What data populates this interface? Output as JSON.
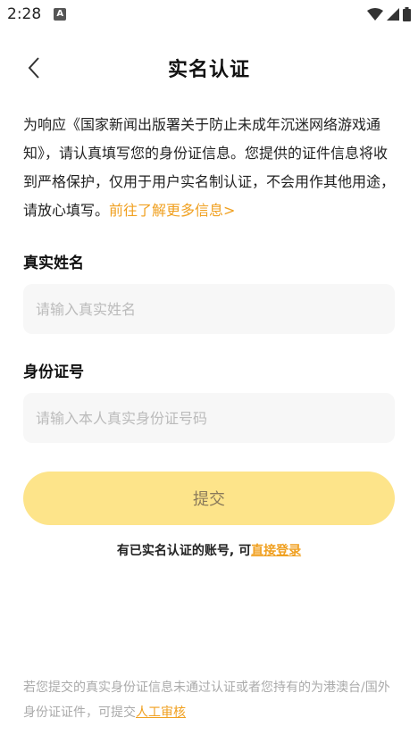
{
  "status_bar": {
    "time": "2:28",
    "notification_glyph": "A"
  },
  "header": {
    "title": "实名认证"
  },
  "intro": {
    "text": "为响应《国家新闻出版署关于防止未成年沉迷网络游戏通知》，请认真填写您的身份证信息。您提供的证件信息将收到严格保护，仅用于用户实名制认证，不会用作其他用途，请放心填写。",
    "link": "前往了解更多信息>"
  },
  "form": {
    "name_label": "真实姓名",
    "name_placeholder": "请输入真实姓名",
    "id_label": "身份证号",
    "id_placeholder": "请输入本人真实身份证号码",
    "submit_label": "提交"
  },
  "login": {
    "text": "有已实名认证的账号, 可",
    "link": "直接登录"
  },
  "footer": {
    "text": "若您提交的真实身份证信息未通过认证或者您持有的为港澳台/国外身份证证件，可提交",
    "link": "人工审核"
  },
  "colors": {
    "accent": "#f0a020",
    "button_bg": "#fde48a",
    "field_bg": "#f7f7f7"
  }
}
